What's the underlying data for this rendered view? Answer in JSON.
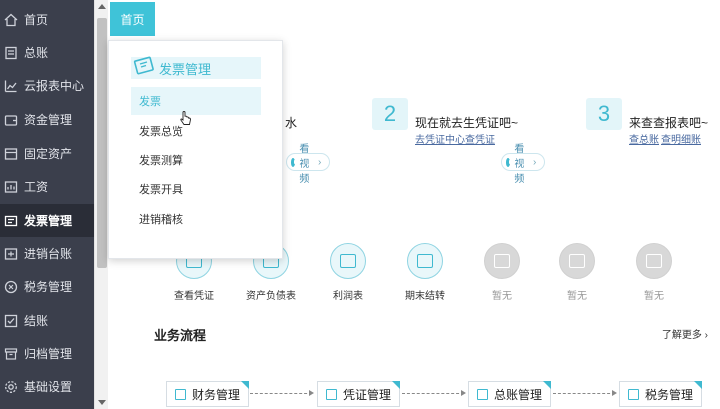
{
  "sidebar": {
    "items": [
      {
        "label": "首页",
        "icon": "home-icon"
      },
      {
        "label": "总账",
        "icon": "ledger-icon"
      },
      {
        "label": "云报表中心",
        "icon": "chart-icon"
      },
      {
        "label": "资金管理",
        "icon": "wallet-icon"
      },
      {
        "label": "固定资产",
        "icon": "asset-icon"
      },
      {
        "label": "工资",
        "icon": "salary-icon"
      },
      {
        "label": "发票管理",
        "icon": "invoice-icon",
        "active": true
      },
      {
        "label": "进销台账",
        "icon": "stock-icon"
      },
      {
        "label": "税务管理",
        "icon": "tax-icon"
      },
      {
        "label": "结账",
        "icon": "close-book-icon"
      },
      {
        "label": "归档管理",
        "icon": "archive-icon"
      },
      {
        "label": "基础设置",
        "icon": "settings-icon"
      }
    ]
  },
  "tab": {
    "label": "首页"
  },
  "steps": [
    {
      "title": "水",
      "video": "看视频"
    },
    {
      "num": "2",
      "title": "现在就去生凭证吧~",
      "links": [
        "去凭证中心",
        "查凭证"
      ],
      "video": "看视频"
    },
    {
      "num": "3",
      "title": "来查查报表吧~",
      "links": [
        "查总账",
        "查明细账"
      ]
    }
  ],
  "shortcuts": [
    {
      "label": "查看凭证"
    },
    {
      "label": "资产负债表"
    },
    {
      "label": "利润表"
    },
    {
      "label": "期末结转"
    },
    {
      "label": "暂无"
    },
    {
      "label": "暂无"
    },
    {
      "label": "暂无"
    }
  ],
  "process": {
    "title": "业务流程",
    "more": "了解更多",
    "steps": [
      "财务管理",
      "凭证管理",
      "总账管理",
      "税务管理"
    ]
  },
  "dropdown": {
    "header": "发票管理",
    "items": [
      "发票",
      "发票总览",
      "发票测算",
      "发票开具",
      "进销稽核"
    ]
  },
  "colors": {
    "accent": "#3fc3d8",
    "sidebar": "#3b3f4c",
    "sidebar_active": "#2a2d37"
  }
}
